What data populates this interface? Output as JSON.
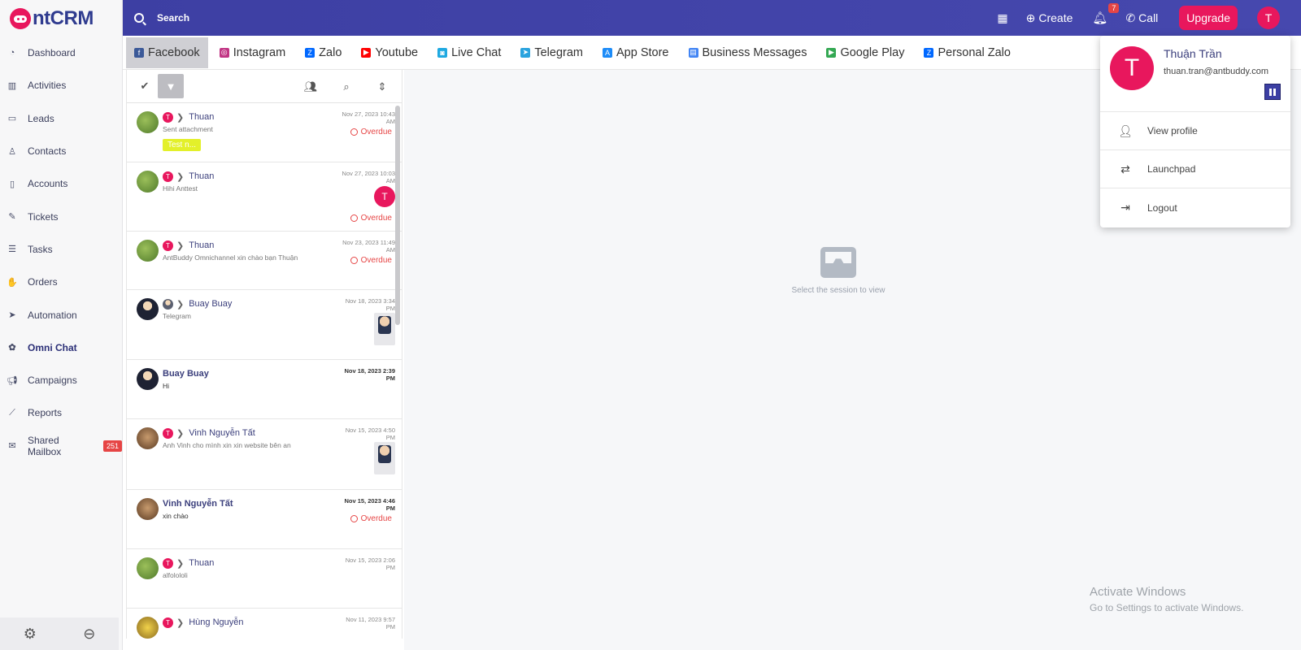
{
  "app": {
    "logo_text": "ntCRM"
  },
  "sidebar": {
    "items": [
      {
        "label": "Dashboard",
        "icon": "dashboard-icon"
      },
      {
        "label": "Activities",
        "icon": "bar-chart-icon"
      },
      {
        "label": "Leads",
        "icon": "card-icon"
      },
      {
        "label": "Contacts",
        "icon": "user-icon"
      },
      {
        "label": "Accounts",
        "icon": "building-icon"
      },
      {
        "label": "Tickets",
        "icon": "ticket-icon"
      },
      {
        "label": "Tasks",
        "icon": "tasks-icon"
      },
      {
        "label": "Orders",
        "icon": "hand-icon"
      },
      {
        "label": "Automation",
        "icon": "rocket-icon"
      },
      {
        "label": "Omni Chat",
        "icon": "omni-icon",
        "active": true
      },
      {
        "label": "Campaigns",
        "icon": "megaphone-icon"
      },
      {
        "label": "Reports",
        "icon": "line-chart-icon"
      },
      {
        "label": "Shared Mailbox",
        "icon": "envelope-icon",
        "badge": "251"
      }
    ]
  },
  "topbar": {
    "search_label": "Search",
    "create_label": "Create",
    "notification_count": "7",
    "call_label": "Call",
    "upgrade_label": "Upgrade",
    "avatar_initial": "T"
  },
  "tabs": [
    {
      "label": "Facebook",
      "color": "#3b5998",
      "active": true
    },
    {
      "label": "Instagram",
      "color": "#c13584"
    },
    {
      "label": "Zalo",
      "color": "#0068ff"
    },
    {
      "label": "Youtube",
      "color": "#ff0000"
    },
    {
      "label": "Live Chat",
      "color": "#1fa9e1"
    },
    {
      "label": "Telegram",
      "color": "#2aa3de"
    },
    {
      "label": "App Store",
      "color": "#1d8cf8"
    },
    {
      "label": "Business Messages",
      "color": "#4285f4"
    },
    {
      "label": "Google Play",
      "color": "#34a853"
    },
    {
      "label": "Personal Zalo",
      "color": "#0068ff"
    }
  ],
  "conversations": [
    {
      "name": "Thuan",
      "message": "Sent attachment",
      "time_line1": "Nov 27, 2023 10:43",
      "time_line2": "AM",
      "overdue": "Overdue",
      "tag": "Test n...",
      "avatar": "green"
    },
    {
      "name": "Thuan",
      "message": "Hihi Anttest",
      "time_line1": "Nov 27, 2023 10:03",
      "time_line2": "AM",
      "overdue": "Overdue",
      "assignee": "T",
      "avatar": "green"
    },
    {
      "name": "Thuan",
      "message": "AntBuddy Omnichannel xin chào bạn Thuận",
      "time_line1": "Nov 23, 2023 11:49",
      "time_line2": "AM",
      "overdue": "Overdue",
      "avatar": "green"
    },
    {
      "name": "Buay Buay",
      "message": "Telegram",
      "time_line1": "Nov 18, 2023 3:34",
      "time_line2": "PM",
      "avatar": "person"
    },
    {
      "name": "Buay Buay",
      "message": "Hi",
      "time_line1": "Nov 18, 2023 2:39",
      "time_line2": "PM",
      "avatar": "person",
      "unread": true
    },
    {
      "name": "Vinh Nguyễn Tất",
      "message": "Anh Vinh cho mình xin xin website bên an",
      "time_line1": "Nov 15, 2023 4:50",
      "time_line2": "PM",
      "avatar": "brown"
    },
    {
      "name": "Vinh Nguyễn Tất",
      "message": "xin chào",
      "time_line1": "Nov 15, 2023 4:46",
      "time_line2": "PM",
      "overdue": "Overdue",
      "avatar": "brown",
      "unread": true
    },
    {
      "name": "Thuan",
      "message": "alfolololi",
      "time_line1": "Nov 15, 2023 2:06",
      "time_line2": "PM",
      "avatar": "green"
    },
    {
      "name": "Hùng Nguyễn",
      "message": "",
      "time_line1": "Nov 11, 2023 9:57",
      "time_line2": "PM",
      "avatar": "yellow"
    }
  ],
  "main": {
    "empty_text": "Select the session to view"
  },
  "profile": {
    "initial": "T",
    "name": "Thuận Trần",
    "email": "thuan.tran@antbuddy.com",
    "menu": [
      {
        "label": "View profile",
        "icon": "user-icon"
      },
      {
        "label": "Launchpad",
        "icon": "swap-icon"
      },
      {
        "label": "Logout",
        "icon": "logout-icon"
      }
    ]
  },
  "watermark": {
    "line1": "Activate Windows",
    "line2": "Go to Settings to activate Windows."
  }
}
